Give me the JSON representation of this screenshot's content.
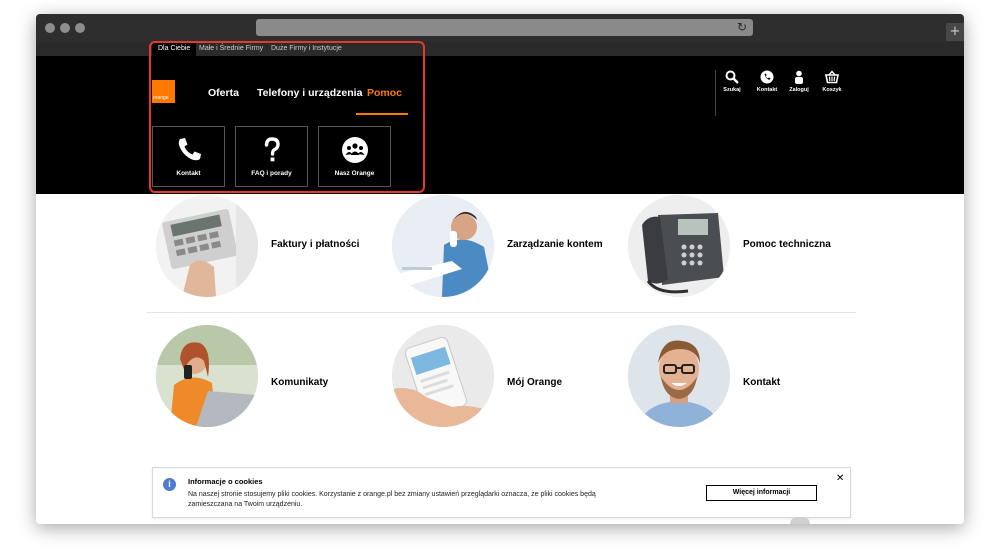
{
  "segments": [
    "Dla Ciebie",
    "Małe i Średnie Firmy",
    "Duże Firmy i Instytucje"
  ],
  "logo_text": "orange",
  "nav": {
    "oferta": "Oferta",
    "telefony": "Telefony i urządzenia",
    "pomoc": "Pomoc"
  },
  "utility": {
    "search": "Szukaj",
    "contact": "Kontakt",
    "login": "Zaloguj",
    "cart": "Koszyk"
  },
  "submenu": {
    "kontakt": "Kontakt",
    "faq": "FAQ i porady",
    "nasz": "Nasz Orange"
  },
  "cards": [
    {
      "title": "Faktury i płatności",
      "icon": "calculator-photo"
    },
    {
      "title": "Zarządzanie kontem",
      "icon": "man-on-phone-photo"
    },
    {
      "title": "Pomoc techniczna",
      "icon": "desk-phone-photo"
    },
    {
      "title": "Komunikaty",
      "icon": "woman-laptop-photo"
    },
    {
      "title": "Mój Orange",
      "icon": "smartphone-photo"
    },
    {
      "title": "Kontakt",
      "icon": "smiling-man-photo"
    }
  ],
  "cookie": {
    "title": "Informacje o cookies",
    "text": "Na naszej stronie stosujemy pliki cookies. Korzystanie z orange.pl bez zmiany ustawień przeglądarki oznacza, że pliki cookies będą zamieszczana na Twoim urządzeniu.",
    "button": "Więcej informacji"
  },
  "colors": {
    "brand": "#ff7900",
    "highlight": "#e8382b",
    "header": "#000000"
  }
}
